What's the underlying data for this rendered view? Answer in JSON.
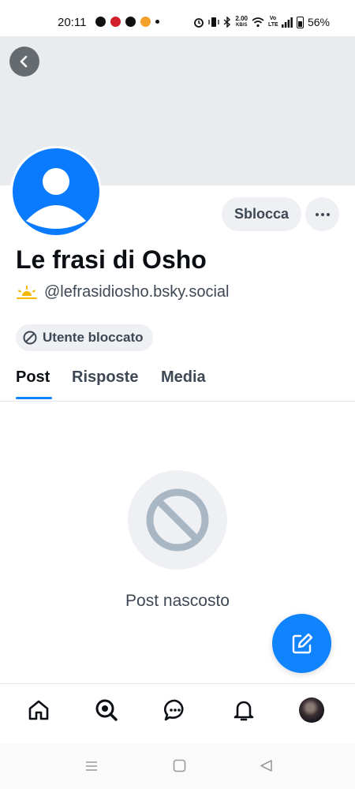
{
  "status_bar": {
    "time": "20:11",
    "network_speed_value": "2.00",
    "network_speed_unit": "KB/S",
    "volte": "Vo LTE",
    "battery": "56%"
  },
  "profile": {
    "display_name": "Le frasi di Osho",
    "handle": "@lefrasidiosho.bsky.social",
    "blocked_label": "Utente bloccato",
    "unblock_label": "Sblocca",
    "more_label": "···"
  },
  "tabs": [
    {
      "label": "Post",
      "active": true
    },
    {
      "label": "Risposte",
      "active": false
    },
    {
      "label": "Media",
      "active": false
    }
  ],
  "content": {
    "hidden_message": "Post nascosto"
  },
  "bottom_nav": {
    "items": [
      "home-icon",
      "search-icon",
      "chat-icon",
      "bell-icon",
      "profile-avatar"
    ]
  },
  "colors": {
    "accent": "#1083fe",
    "avatar_blue": "#0a7aff",
    "muted_text": "#3e4854",
    "pill_bg": "#eef0f3",
    "banner_bg": "#eaebee"
  }
}
